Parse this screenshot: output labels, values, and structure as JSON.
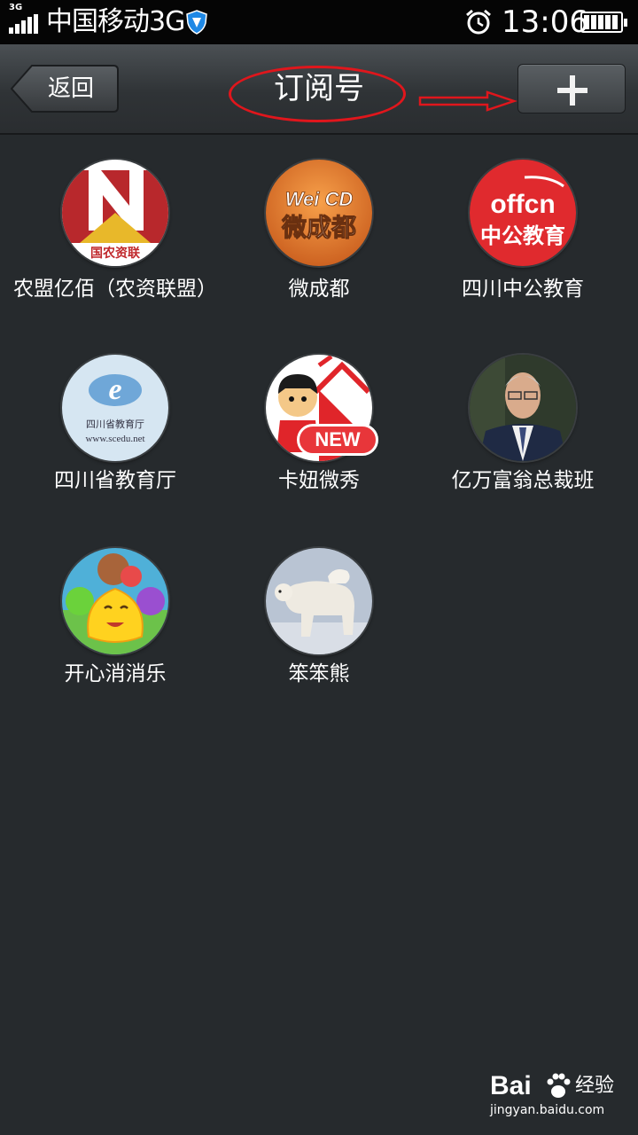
{
  "status_bar": {
    "network_type": "3G",
    "carrier": "中国移动3G",
    "time": "13:06",
    "icons": [
      "signal-icon",
      "shield-icon",
      "alarm-icon",
      "battery-icon"
    ]
  },
  "header": {
    "back_label": "返回",
    "title": "订阅号",
    "add_icon": "plus-icon"
  },
  "accounts": [
    {
      "name": "农盟亿佰（农资联盟）",
      "icon": "nongmeng-logo"
    },
    {
      "name": "微成都",
      "icon": "weichengdu-logo",
      "logo_text": "Wei CD",
      "logo_subtext": "微成都"
    },
    {
      "name": "四川中公教育",
      "icon": "offcn-logo",
      "logo_text": "offcn",
      "logo_subtext": "中公教育"
    },
    {
      "name": "四川省教育厅",
      "icon": "sichuan-education-logo",
      "logo_text": "四川省教育厅",
      "logo_subtext": "www.scedu.net"
    },
    {
      "name": "卡妞微秀",
      "icon": "kaniu-logo",
      "badge": "NEW"
    },
    {
      "name": "亿万富翁总裁班",
      "icon": "portrait-photo"
    },
    {
      "name": "开心消消乐",
      "icon": "happy-match-game-logo"
    },
    {
      "name": "笨笨熊",
      "icon": "polar-bear-photo"
    }
  ],
  "watermark": {
    "brand": "Bai",
    "brand_cn": "经验",
    "url": "jingyan.baidu.com"
  },
  "colors": {
    "background": "#262a2d",
    "annotation_red": "#e0161c",
    "offcn_red": "#e02a2e",
    "new_badge": "#e8363a"
  }
}
